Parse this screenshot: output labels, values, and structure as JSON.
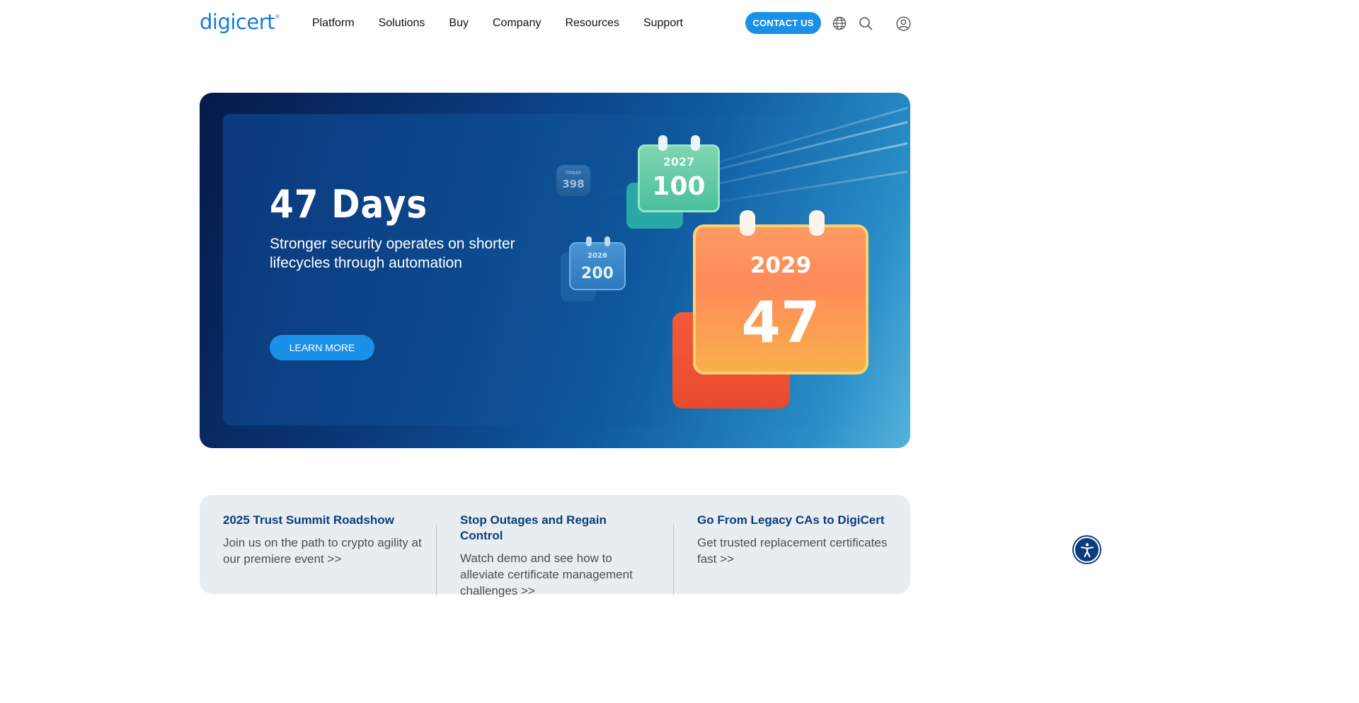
{
  "header": {
    "logo_text": "digicert",
    "logo_mark": "®",
    "nav": [
      "Platform",
      "Solutions",
      "Buy",
      "Company",
      "Resources",
      "Support"
    ],
    "contact_label": "CONTACT US",
    "icons": [
      "globe-icon",
      "search-icon",
      "user-account-icon"
    ],
    "accent_color": "#1a90e8"
  },
  "hero": {
    "title": "47 Days",
    "subtitle": "Stronger security operates on shorter lifecycles through automation",
    "cta_label": "LEARN MORE",
    "calendars": [
      {
        "year": "2029",
        "days": "47"
      },
      {
        "year": "2027",
        "days": "100"
      },
      {
        "year": "2026",
        "days": "200"
      },
      {
        "year": "TODAY",
        "days": "398"
      }
    ]
  },
  "cards": [
    {
      "title": "2025 Trust Summit Roadshow",
      "text": "Join us on the path to crypto agility at our premiere event >>"
    },
    {
      "title": "Stop Outages and Regain Control",
      "text": "Watch demo and see how to alleviate certificate management challenges >>"
    },
    {
      "title": "Go From Legacy CAs to DigiCert",
      "text": "Get trusted replacement certificates fast >>"
    }
  ],
  "accessibility": {
    "icon": "accessibility-icon"
  }
}
